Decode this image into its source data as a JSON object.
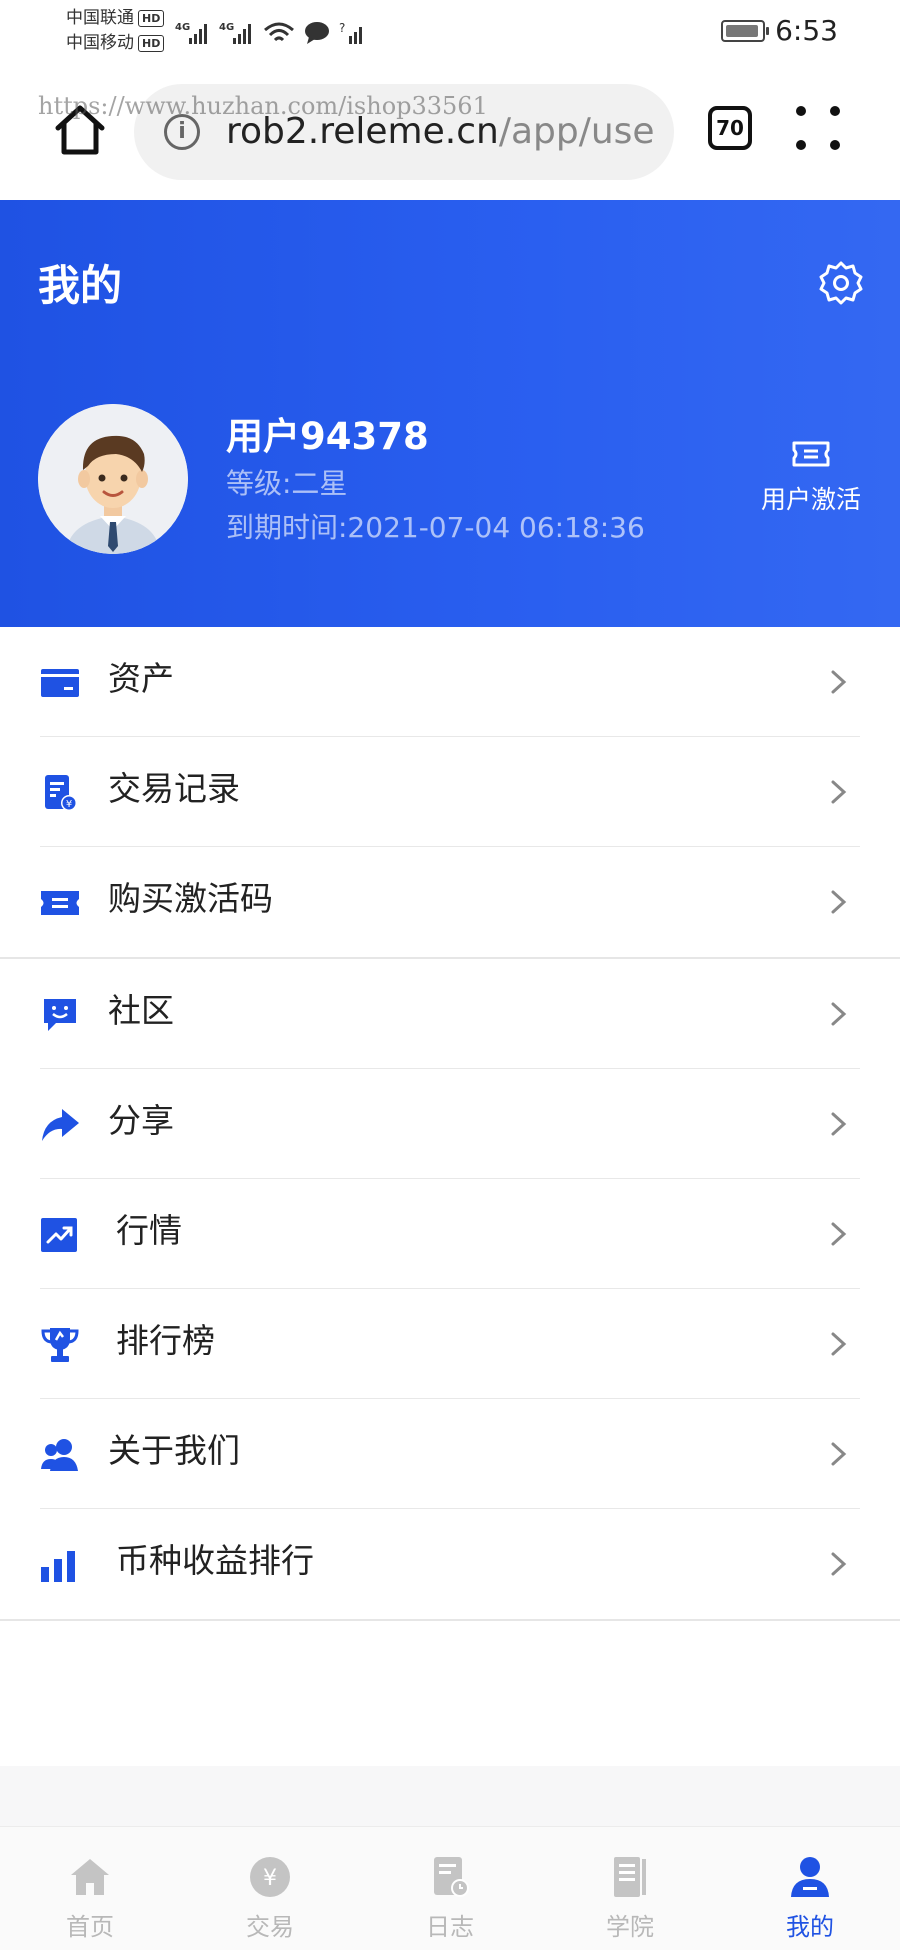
{
  "status_bar": {
    "carrier_1": "中国联通",
    "carrier_2": "中国移动",
    "hd": "HD",
    "time": "6:53"
  },
  "browser": {
    "url_host": "rob2.releme.cn",
    "url_path": "/app/use",
    "tab_count": "70",
    "watermark": "https://www.huzhan.com/ishop33561"
  },
  "header": {
    "title": "我的",
    "username": "用户94378",
    "level": "等级:二星",
    "expire": "到期时间:2021-07-04 06:18:36",
    "activate_label": "用户激活"
  },
  "menu": {
    "group_1": [
      {
        "label": "资产",
        "icon": "wallet-icon"
      },
      {
        "label": "交易记录",
        "icon": "receipt-icon"
      },
      {
        "label": "购买激活码",
        "icon": "ticket-icon"
      }
    ],
    "group_2": [
      {
        "label": "社区",
        "icon": "chat-icon"
      },
      {
        "label": "分享",
        "icon": "share-icon"
      },
      {
        "label": "行情",
        "icon": "trend-chart-icon"
      },
      {
        "label": "排行榜",
        "icon": "trophy-icon"
      },
      {
        "label": "关于我们",
        "icon": "team-icon"
      },
      {
        "label": "币种收益排行",
        "icon": "bar-chart-icon"
      }
    ]
  },
  "tabbar": {
    "items": [
      {
        "label": "首页",
        "icon": "home-icon"
      },
      {
        "label": "交易",
        "icon": "yen-coin-icon"
      },
      {
        "label": "日志",
        "icon": "log-icon"
      },
      {
        "label": "学院",
        "icon": "book-icon"
      },
      {
        "label": "我的",
        "icon": "user-icon"
      }
    ],
    "active_index": 4
  },
  "colors": {
    "accent": "#1f52e3",
    "inactive": "#b8b8b8"
  }
}
